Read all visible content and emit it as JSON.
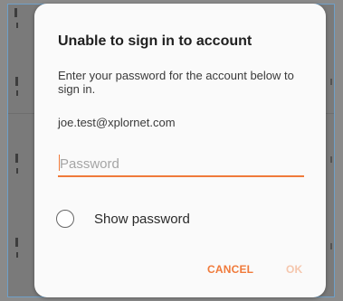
{
  "dialog": {
    "title": "Unable to sign in to account",
    "message": "Enter your password for the account below to sign in.",
    "account_email": "joe.test@xplornet.com",
    "password_field": {
      "value": "",
      "placeholder": "Password"
    },
    "show_password": {
      "label": "Show password",
      "checked": false
    },
    "buttons": {
      "cancel_label": "CANCEL",
      "ok_label": "OK",
      "ok_enabled": false
    }
  },
  "colors": {
    "accent": "#f07a3a",
    "accent_disabled": "#f5c6ad",
    "dialog_background": "#fafafa",
    "scrim": "#7a7a7a"
  }
}
